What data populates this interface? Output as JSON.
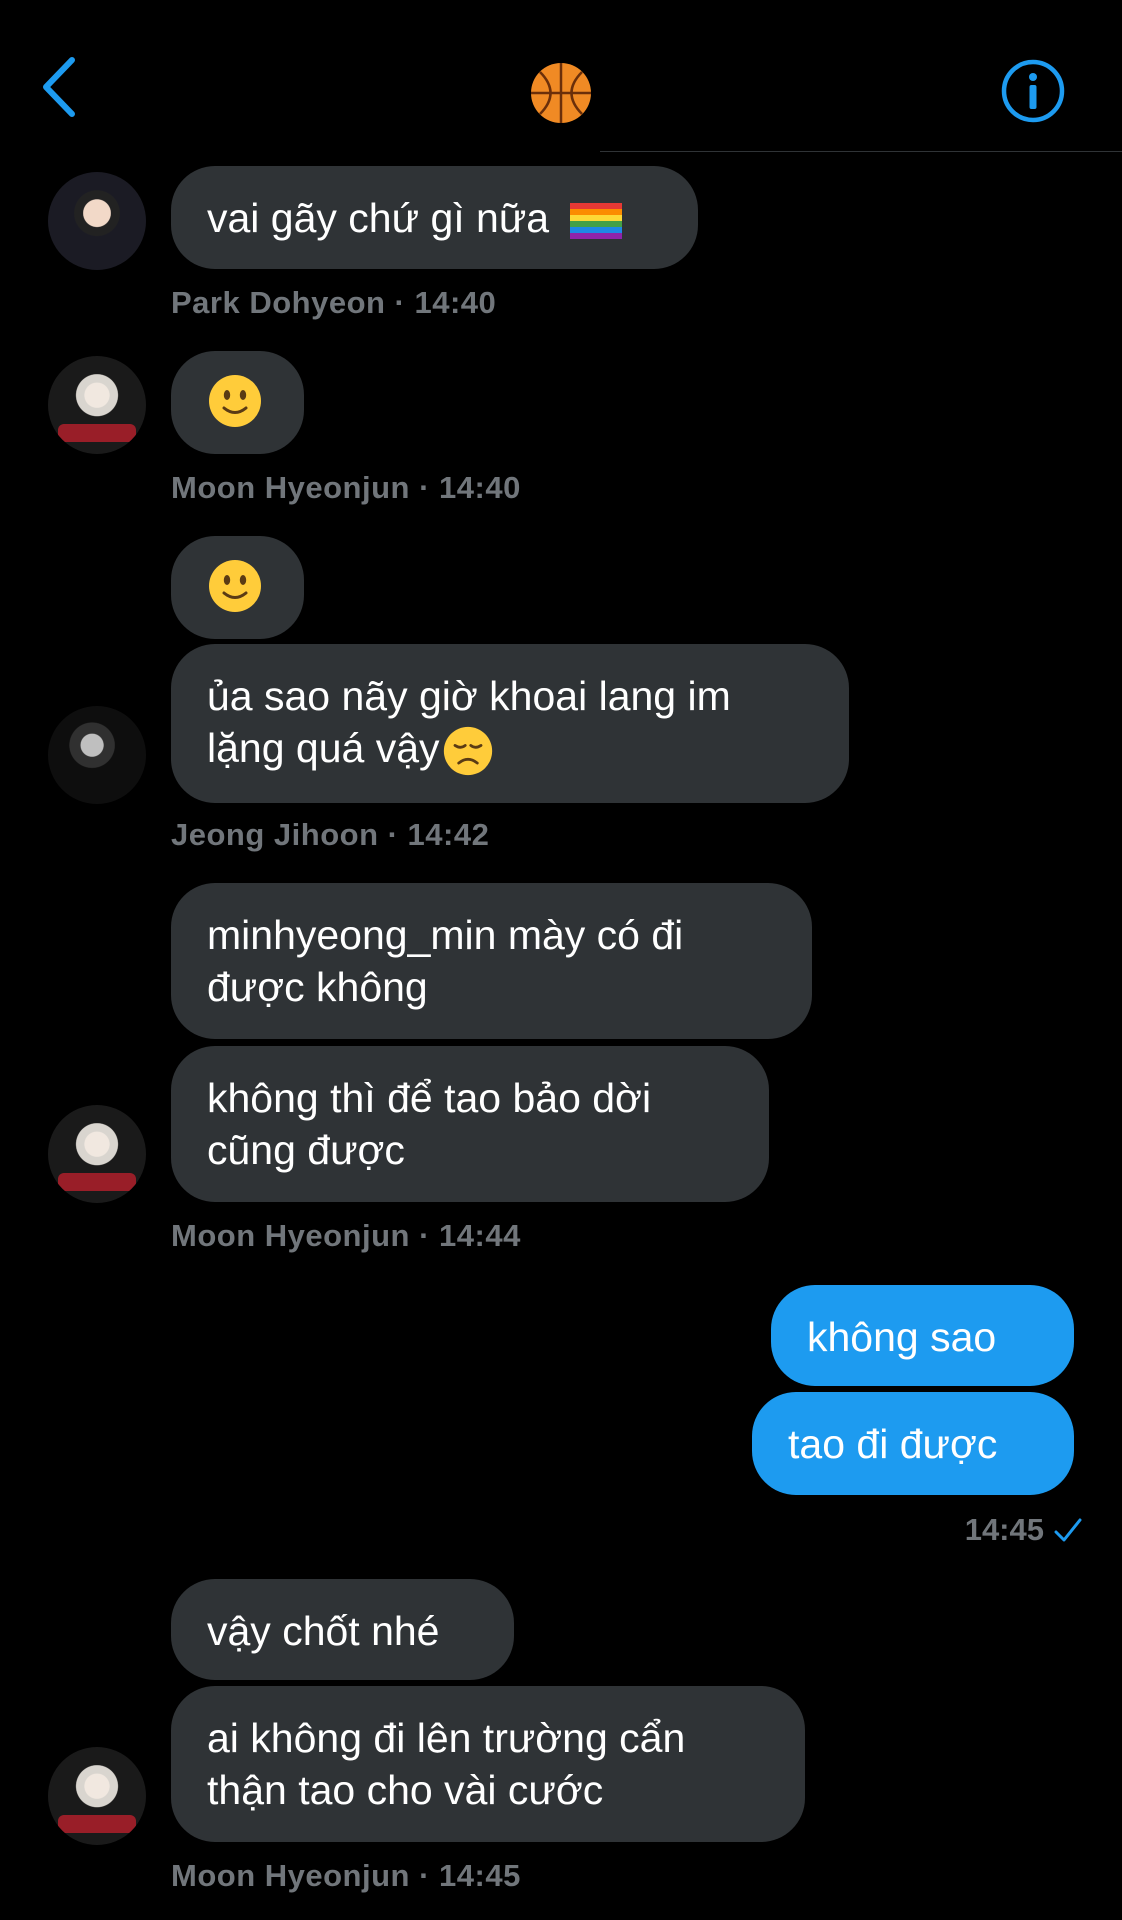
{
  "header": {
    "back_icon": "chevron-left-icon",
    "group_icon": "basketball-icon",
    "info_icon": "info-icon",
    "accent_color": "#1d9bf0"
  },
  "messages": [
    {
      "text": "vai gãy chứ gì nữa",
      "emoji": "rainbow-flag"
    },
    {
      "meta": "Park Dohyeon · 14:40"
    },
    {
      "emoji": "slightly-smiling-face"
    },
    {
      "meta": "Moon Hyeonjun · 14:40"
    },
    {
      "emoji": "slightly-smiling-face"
    },
    {
      "text": "ủa sao nãy giờ khoai lang im lặng quá vậy",
      "emoji": "disappointed-face"
    },
    {
      "meta": "Jeong Jihoon · 14:42"
    },
    {
      "text": "minhyeong_min mày có đi được không"
    },
    {
      "text": "không thì để tao bảo dời cũng được"
    },
    {
      "meta": "Moon Hyeonjun · 14:44"
    },
    {
      "text": "không sao",
      "sent": true
    },
    {
      "text": "tao đi được",
      "sent": true
    },
    {
      "meta": "14:45",
      "sent": true
    },
    {
      "text": "vậy chốt nhé"
    },
    {
      "text": "ai không đi lên trường cẩn thận tao cho vài cước"
    },
    {
      "meta": "Moon Hyeonjun · 14:45"
    }
  ]
}
